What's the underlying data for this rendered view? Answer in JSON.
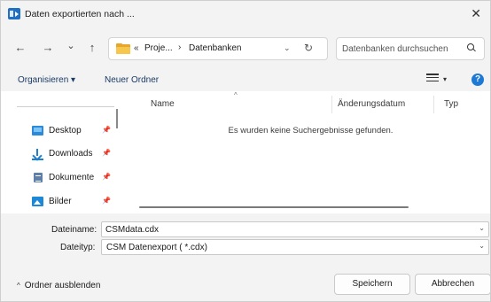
{
  "window": {
    "title": "Daten exportierten nach ...",
    "close_glyph": "✕"
  },
  "nav": {
    "back_glyph": "←",
    "forward_glyph": "→",
    "recent_glyph": "⌄",
    "up_glyph": "↑",
    "address": {
      "overflow_glyph": "«",
      "crumb1": "Proje...",
      "separator": "›",
      "crumb2": "Datenbanken",
      "dropdown_glyph": "⌄",
      "refresh_glyph": "↻"
    },
    "search_placeholder": "Datenbanken durchsuchen"
  },
  "toolbar": {
    "organize_label": "Organisieren ▾",
    "new_folder_label": "Neuer Ordner",
    "view_dropdown_glyph": "▾",
    "help_glyph": "?"
  },
  "sidebar": {
    "items": [
      {
        "label": "Desktop",
        "icon": "desktop-icon"
      },
      {
        "label": "Downloads",
        "icon": "downloads-icon"
      },
      {
        "label": "Dokumente",
        "icon": "documents-icon"
      },
      {
        "label": "Bilder",
        "icon": "pictures-icon"
      }
    ],
    "pin_glyph": "📌"
  },
  "filelist": {
    "sort_glyph": "^",
    "columns": [
      "Name",
      "Änderungsdatum",
      "Typ"
    ],
    "empty_message": "Es wurden keine Suchergebnisse gefunden."
  },
  "form": {
    "filename_label": "Dateiname:",
    "filename_value": "CSMdata.cdx",
    "filetype_label": "Dateityp:",
    "filetype_value": "CSM Datenexport  ( *.cdx)",
    "dropdown_glyph": "⌄"
  },
  "footer": {
    "hide_folders_glyph": "^",
    "hide_folders_label": "Ordner ausblenden",
    "save_label": "Speichern",
    "cancel_label": "Abbrechen"
  },
  "colors": {
    "accent": "#1e79d4",
    "folder": "#f7c64c",
    "background": "#f3f3f3"
  }
}
